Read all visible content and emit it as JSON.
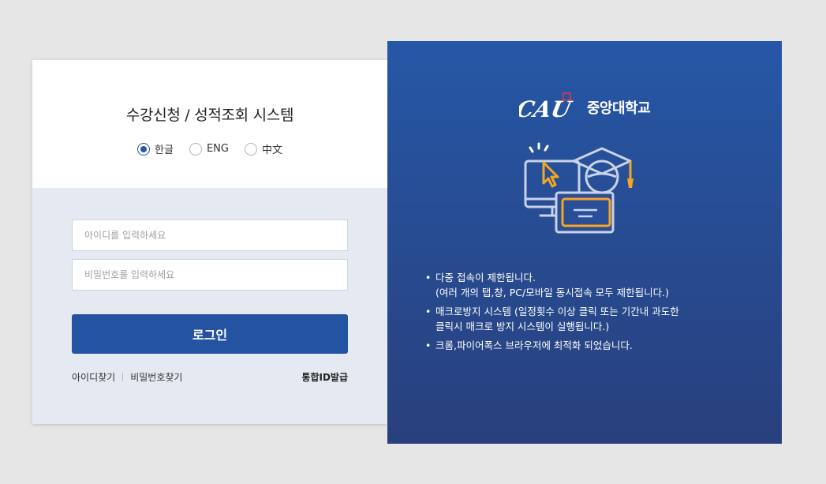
{
  "app": {
    "title": "수강신청 / 성적조회 시스템"
  },
  "language": {
    "selected": "ko",
    "options": [
      {
        "id": "ko",
        "label": "한글"
      },
      {
        "id": "en",
        "label": "ENG"
      },
      {
        "id": "zh",
        "label": "中文"
      }
    ]
  },
  "login": {
    "id_placeholder": "아이디를 입력하세요",
    "id_value": "",
    "pw_placeholder": "비밀번호를 입력하세요",
    "pw_value": "",
    "button_label": "로그인"
  },
  "links": {
    "find_id": "아이디찾기",
    "find_pw": "비밀번호찾기",
    "integrated_id": "통합ID발급"
  },
  "brand": {
    "logo_text": "CAU",
    "university_name": "중앙대학교",
    "primary_color": "#2453a2",
    "accent_color": "#f5a623"
  },
  "illustration": {
    "icon": "online-education-icon"
  },
  "notices": [
    {
      "line1": "다중 접속이 제한됩니다.",
      "line2": "(여러 개의 탭,창, PC/모바일 동시접속 모두 제한됩니다.)"
    },
    {
      "line1": "매크로방지 시스템 (일정횟수 이상 클릭 또는 기간내 과도한",
      "line2": "클릭시 매크로 방지 시스템이 실행됩니다.)"
    },
    {
      "line1": "크롬,파이어폭스 브라우저에 최적화 되었습니다.",
      "line2": ""
    }
  ]
}
